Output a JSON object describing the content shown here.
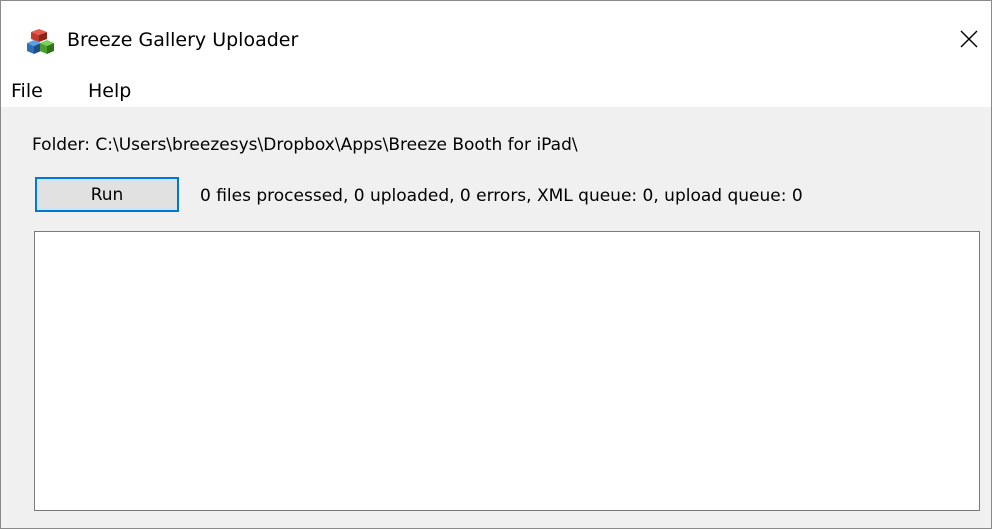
{
  "window": {
    "title": "Breeze Gallery Uploader",
    "app_icon": "cubes-app-icon",
    "close_icon": "close-icon"
  },
  "menu": {
    "items": [
      {
        "label": "File"
      },
      {
        "label": "Help"
      }
    ]
  },
  "main": {
    "folder_text": "Folder: C:\\Users\\breezesys\\Dropbox\\Apps\\Breeze Booth for iPad\\",
    "run_label": "Run",
    "status_text": "0 files processed, 0 uploaded, 0 errors, XML queue: 0, upload queue: 0",
    "log_value": ""
  },
  "colors": {
    "accent": "#0078d7",
    "background": "#f0f0f0",
    "button_face": "#e1e1e1"
  }
}
